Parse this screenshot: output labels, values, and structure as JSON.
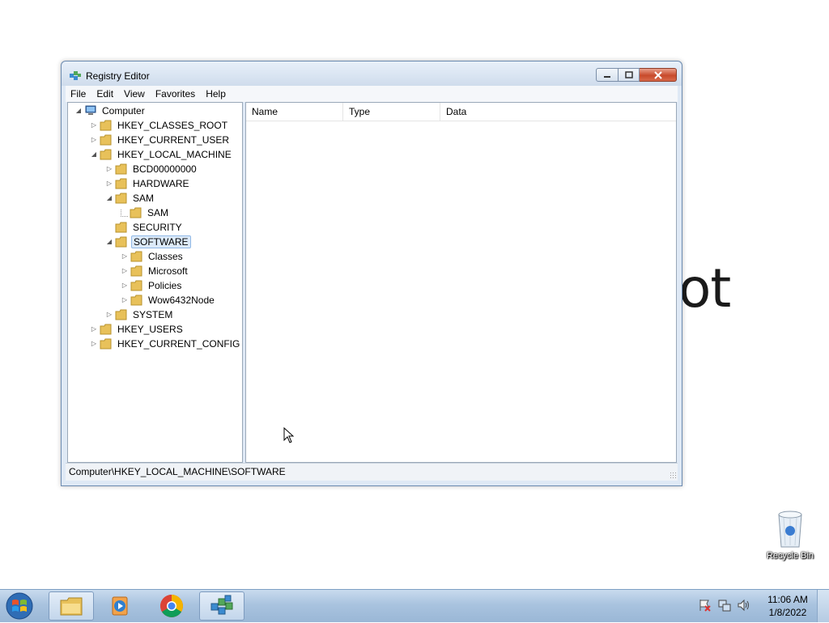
{
  "desktop": {
    "background_text": "ot",
    "recycle_bin_label": "Recycle Bin"
  },
  "window": {
    "title": "Registry Editor",
    "menu": [
      "File",
      "Edit",
      "View",
      "Favorites",
      "Help"
    ],
    "tree": [
      {
        "label": "Computer",
        "arrow": "◢",
        "icon": "computer-icon"
      },
      {
        "label": "HKEY_CLASSES_ROOT",
        "arrow": "▷"
      },
      {
        "label": "HKEY_CURRENT_USER",
        "arrow": "▷"
      },
      {
        "label": "HKEY_LOCAL_MACHINE",
        "arrow": "◢"
      },
      {
        "label": "BCD00000000",
        "arrow": "▷"
      },
      {
        "label": "HARDWARE",
        "arrow": "▷"
      },
      {
        "label": "SAM",
        "arrow": "◢"
      },
      {
        "label": "SAM",
        "arrow": ""
      },
      {
        "label": "SECURITY",
        "arrow": ""
      },
      {
        "label": "SOFTWARE",
        "arrow": "◢",
        "selected": true
      },
      {
        "label": "Classes",
        "arrow": "▷"
      },
      {
        "label": "Microsoft",
        "arrow": "▷"
      },
      {
        "label": "Policies",
        "arrow": "▷"
      },
      {
        "label": "Wow6432Node",
        "arrow": "▷"
      },
      {
        "label": "SYSTEM",
        "arrow": "▷"
      },
      {
        "label": "HKEY_USERS",
        "arrow": "▷"
      },
      {
        "label": "HKEY_CURRENT_CONFIG",
        "arrow": "▷"
      }
    ],
    "columns": [
      "Name",
      "Type",
      "Data"
    ],
    "status": "Computer\\HKEY_LOCAL_MACHINE\\SOFTWARE"
  },
  "taskbar": {
    "time": "11:06 AM",
    "date": "1/8/2022",
    "apps": [
      "file-explorer-icon",
      "media-player-icon",
      "chrome-icon",
      "regedit-icon"
    ]
  },
  "colors": {
    "selection_bg": "#dceaf9",
    "selection_border": "#90b8e6",
    "folder": "#e8c15a"
  }
}
